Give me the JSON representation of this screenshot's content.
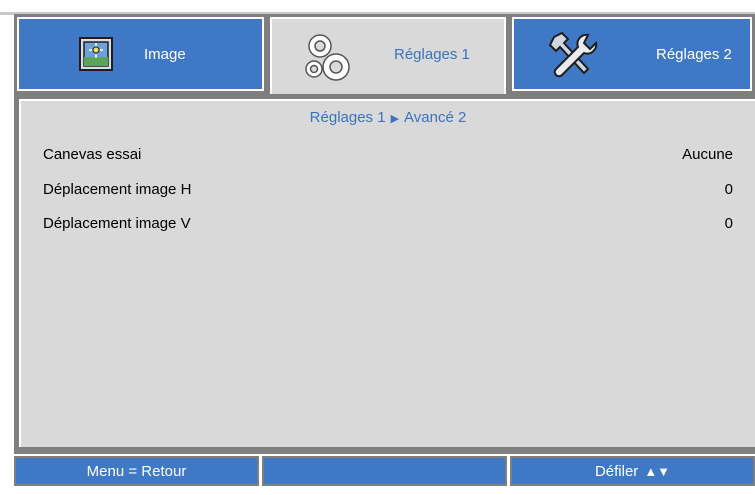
{
  "tabs": [
    {
      "label": "Image",
      "icon": "image-icon",
      "active": false
    },
    {
      "label": "Réglages 1",
      "icon": "gears-icon",
      "active": true
    },
    {
      "label": "Réglages 2",
      "icon": "tools-icon",
      "active": false
    }
  ],
  "breadcrumb": {
    "parent": "Réglages 1",
    "separator_icon": "right-triangle-icon",
    "current": "Avancé 2"
  },
  "rows": [
    {
      "label": "Canevas essai",
      "value": "Aucune"
    },
    {
      "label": "Déplacement image H",
      "value": "0"
    },
    {
      "label": "Déplacement image V",
      "value": "0"
    }
  ],
  "footer": {
    "menu_label": "Menu = Retour",
    "middle_label": "",
    "scroll_label": "Défiler",
    "scroll_icons": "▲▼"
  },
  "colors": {
    "accent_blue": "#3f78c4",
    "text_blue": "#3a74c0",
    "panel_gray": "#d9d9d9",
    "frame_gray": "#7f7f7f"
  }
}
